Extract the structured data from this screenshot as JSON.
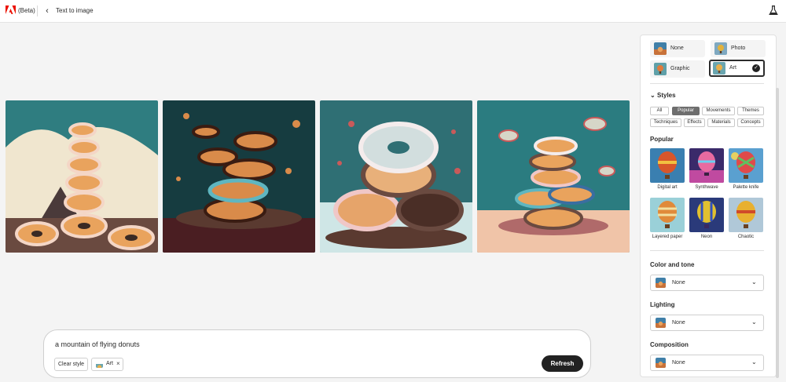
{
  "header": {
    "beta_label": "(Beta)",
    "back_label": "‹",
    "title": "Text to image"
  },
  "gallery": {
    "images": [
      {
        "alt": "Donut tower with mountain background"
      },
      {
        "alt": "Donuts flying over chocolate"
      },
      {
        "alt": "Large sprinkled donut on stack"
      },
      {
        "alt": "Colorful donut stack"
      }
    ]
  },
  "prompt": {
    "text": "a mountain of flying donuts",
    "clear_style": "Clear style",
    "chip_label": "Art",
    "chip_remove": "×",
    "refresh": "Refresh"
  },
  "panel": {
    "content_types": [
      {
        "label": "None",
        "selected": false
      },
      {
        "label": "Photo",
        "selected": false
      },
      {
        "label": "Graphic",
        "selected": false
      },
      {
        "label": "Art",
        "selected": true
      }
    ],
    "check_mark": "✓",
    "styles_title": "Styles",
    "style_tags": [
      {
        "label": "All",
        "active": false
      },
      {
        "label": "Popular",
        "active": true
      },
      {
        "label": "Movements",
        "active": false
      },
      {
        "label": "Themes",
        "active": false
      },
      {
        "label": "Techniques",
        "active": false
      },
      {
        "label": "Effects",
        "active": false
      },
      {
        "label": "Materials",
        "active": false
      },
      {
        "label": "Concepts",
        "active": false
      }
    ],
    "popular_title": "Popular",
    "popular_styles": [
      {
        "label": "Digital art"
      },
      {
        "label": "Synthwave"
      },
      {
        "label": "Palette knife"
      },
      {
        "label": "Layered paper"
      },
      {
        "label": "Neon"
      },
      {
        "label": "Chaotic"
      }
    ],
    "color_tone": {
      "title": "Color and tone",
      "value": "None"
    },
    "lighting": {
      "title": "Lighting",
      "value": "None"
    },
    "composition": {
      "title": "Composition",
      "value": "None"
    }
  },
  "colors": {
    "accent": "#eb1000",
    "button_dark": "#222222",
    "active_tag": "#6e6e6e"
  }
}
